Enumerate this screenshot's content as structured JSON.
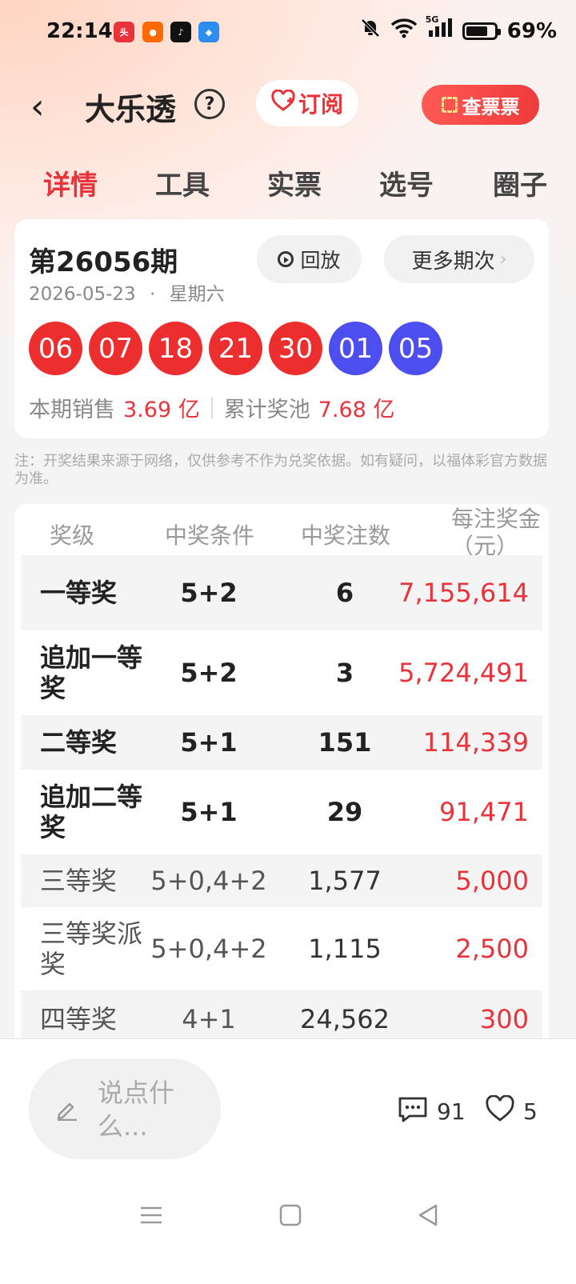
{
  "status": {
    "time": "22:14",
    "battery": "69%",
    "network": "5G"
  },
  "header": {
    "title": "大乐透",
    "subscribe_label": "订阅",
    "check_ticket_label": "查票票"
  },
  "tabs": [
    "详情",
    "工具",
    "实票",
    "选号",
    "圈子"
  ],
  "draw": {
    "period": "第26056期",
    "date": "2026-05-23",
    "weekday": "星期六",
    "replay_label": "回放",
    "more_label": "更多期次",
    "red_balls": [
      "06",
      "07",
      "18",
      "21",
      "30"
    ],
    "blue_balls": [
      "01",
      "05"
    ],
    "sales_label": "本期销售",
    "sales_value": "3.69 亿",
    "pool_label": "累计奖池",
    "pool_value": "7.68 亿"
  },
  "note": "注：开奖结果来源于网络，仅供参考不作为兑奖依据。如有疑问，以福体彩官方数据为准。",
  "prize_table": {
    "headers": [
      "奖级",
      "中奖条件",
      "中奖注数",
      "每注奖金（元）"
    ],
    "rows": [
      {
        "level": "一等奖",
        "condition": "5+2",
        "count": "6",
        "amount": "7,155,614"
      },
      {
        "level": "追加一等奖",
        "condition": "5+2",
        "count": "3",
        "amount": "5,724,491"
      },
      {
        "level": "二等奖",
        "condition": "5+1",
        "count": "151",
        "amount": "114,339"
      },
      {
        "level": "追加二等奖",
        "condition": "5+1",
        "count": "29",
        "amount": "91,471"
      },
      {
        "level": "三等奖",
        "condition": "5+0,4+2",
        "count": "1,577",
        "amount": "5,000"
      },
      {
        "level": "三等奖派奖",
        "condition": "5+0,4+2",
        "count": "1,115",
        "amount": "2,500"
      },
      {
        "level": "四等奖",
        "condition": "4+1",
        "count": "24,562",
        "amount": "300"
      }
    ]
  },
  "bottom": {
    "comment_placeholder": "说点什么...",
    "comments": "91",
    "likes": "5"
  },
  "colors": {
    "accent_red": "#e8333a",
    "ball_red": "#ec2e2e",
    "ball_blue": "#4d4ef0"
  }
}
